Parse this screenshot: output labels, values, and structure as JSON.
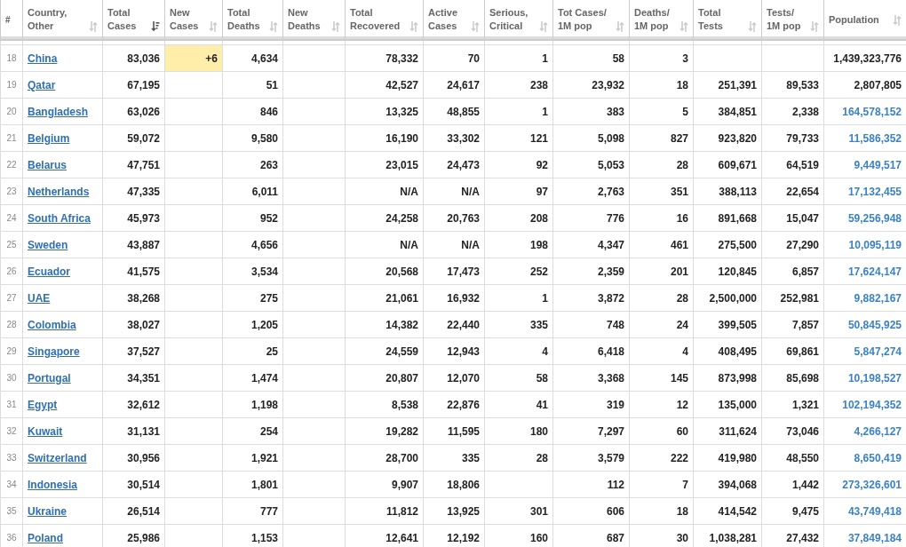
{
  "table": {
    "columns": [
      {
        "label": "#"
      },
      {
        "label": "Country,\nOther",
        "sorted": false
      },
      {
        "label": "Total\nCases",
        "sorted": true
      },
      {
        "label": "New\nCases",
        "sorted": false
      },
      {
        "label": "Total\nDeaths",
        "sorted": false
      },
      {
        "label": "New\nDeaths",
        "sorted": false
      },
      {
        "label": "Total\nRecovered",
        "sorted": false
      },
      {
        "label": "Active\nCases",
        "sorted": false
      },
      {
        "label": "Serious,\nCritical",
        "sorted": false
      },
      {
        "label": "Tot Cases/\n1M pop",
        "sorted": false
      },
      {
        "label": "Deaths/\n1M pop",
        "sorted": false
      },
      {
        "label": "Total\nTests",
        "sorted": false
      },
      {
        "label": "Tests/\n1M pop",
        "sorted": false
      },
      {
        "label": "Population",
        "sorted": false
      }
    ],
    "rows": [
      {
        "cells": [
          "18",
          "China",
          "83,036",
          "+6",
          "4,634",
          "",
          "78,332",
          "70",
          "1",
          "58",
          "3",
          "",
          "",
          "1,439,323,776"
        ],
        "population_link": false
      },
      {
        "cells": [
          "19",
          "Qatar",
          "67,195",
          "",
          "51",
          "",
          "42,527",
          "24,617",
          "238",
          "23,932",
          "18",
          "251,391",
          "89,533",
          "2,807,805"
        ],
        "population_link": false
      },
      {
        "cells": [
          "20",
          "Bangladesh",
          "63,026",
          "",
          "846",
          "",
          "13,325",
          "48,855",
          "1",
          "383",
          "5",
          "384,851",
          "2,338",
          "164,578,152"
        ],
        "population_link": true
      },
      {
        "cells": [
          "21",
          "Belgium",
          "59,072",
          "",
          "9,580",
          "",
          "16,190",
          "33,302",
          "121",
          "5,098",
          "827",
          "923,820",
          "79,733",
          "11,586,352"
        ],
        "population_link": true
      },
      {
        "cells": [
          "22",
          "Belarus",
          "47,751",
          "",
          "263",
          "",
          "23,015",
          "24,473",
          "92",
          "5,053",
          "28",
          "609,671",
          "64,519",
          "9,449,517"
        ],
        "population_link": true
      },
      {
        "cells": [
          "23",
          "Netherlands",
          "47,335",
          "",
          "6,011",
          "",
          "N/A",
          "N/A",
          "97",
          "2,763",
          "351",
          "388,113",
          "22,654",
          "17,132,455"
        ],
        "population_link": true
      },
      {
        "cells": [
          "24",
          "South Africa",
          "45,973",
          "",
          "952",
          "",
          "24,258",
          "20,763",
          "208",
          "776",
          "16",
          "891,668",
          "15,047",
          "59,256,948"
        ],
        "population_link": true
      },
      {
        "cells": [
          "25",
          "Sweden",
          "43,887",
          "",
          "4,656",
          "",
          "N/A",
          "N/A",
          "198",
          "4,347",
          "461",
          "275,500",
          "27,290",
          "10,095,119"
        ],
        "population_link": true
      },
      {
        "cells": [
          "26",
          "Ecuador",
          "41,575",
          "",
          "3,534",
          "",
          "20,568",
          "17,473",
          "252",
          "2,359",
          "201",
          "120,845",
          "6,857",
          "17,624,147"
        ],
        "population_link": true
      },
      {
        "cells": [
          "27",
          "UAE",
          "38,268",
          "",
          "275",
          "",
          "21,061",
          "16,932",
          "1",
          "3,872",
          "28",
          "2,500,000",
          "252,981",
          "9,882,167"
        ],
        "population_link": true
      },
      {
        "cells": [
          "28",
          "Colombia",
          "38,027",
          "",
          "1,205",
          "",
          "14,382",
          "22,440",
          "335",
          "748",
          "24",
          "399,505",
          "7,857",
          "50,845,925"
        ],
        "population_link": true
      },
      {
        "cells": [
          "29",
          "Singapore",
          "37,527",
          "",
          "25",
          "",
          "24,559",
          "12,943",
          "4",
          "6,418",
          "4",
          "408,495",
          "69,861",
          "5,847,274"
        ],
        "population_link": true
      },
      {
        "cells": [
          "30",
          "Portugal",
          "34,351",
          "",
          "1,474",
          "",
          "20,807",
          "12,070",
          "58",
          "3,368",
          "145",
          "873,998",
          "85,698",
          "10,198,527"
        ],
        "population_link": true
      },
      {
        "cells": [
          "31",
          "Egypt",
          "32,612",
          "",
          "1,198",
          "",
          "8,538",
          "22,876",
          "41",
          "319",
          "12",
          "135,000",
          "1,321",
          "102,194,352"
        ],
        "population_link": true
      },
      {
        "cells": [
          "32",
          "Kuwait",
          "31,131",
          "",
          "254",
          "",
          "19,282",
          "11,595",
          "180",
          "7,297",
          "60",
          "311,624",
          "73,046",
          "4,266,127"
        ],
        "population_link": true
      },
      {
        "cells": [
          "33",
          "Switzerland",
          "30,956",
          "",
          "1,921",
          "",
          "28,700",
          "335",
          "28",
          "3,579",
          "222",
          "419,980",
          "48,550",
          "8,650,419"
        ],
        "population_link": true
      },
      {
        "cells": [
          "34",
          "Indonesia",
          "30,514",
          "",
          "1,801",
          "",
          "9,907",
          "18,806",
          "",
          "112",
          "7",
          "394,068",
          "1,442",
          "273,326,601"
        ],
        "population_link": true
      },
      {
        "cells": [
          "35",
          "Ukraine",
          "26,514",
          "",
          "777",
          "",
          "11,812",
          "13,925",
          "301",
          "606",
          "18",
          "414,542",
          "9,475",
          "43,749,418"
        ],
        "population_link": true
      },
      {
        "cells": [
          "36",
          "Poland",
          "25,986",
          "",
          "1,153",
          "",
          "12,641",
          "12,192",
          "160",
          "687",
          "30",
          "1,038,281",
          "27,432",
          "37,849,184"
        ],
        "population_link": true
      }
    ]
  }
}
